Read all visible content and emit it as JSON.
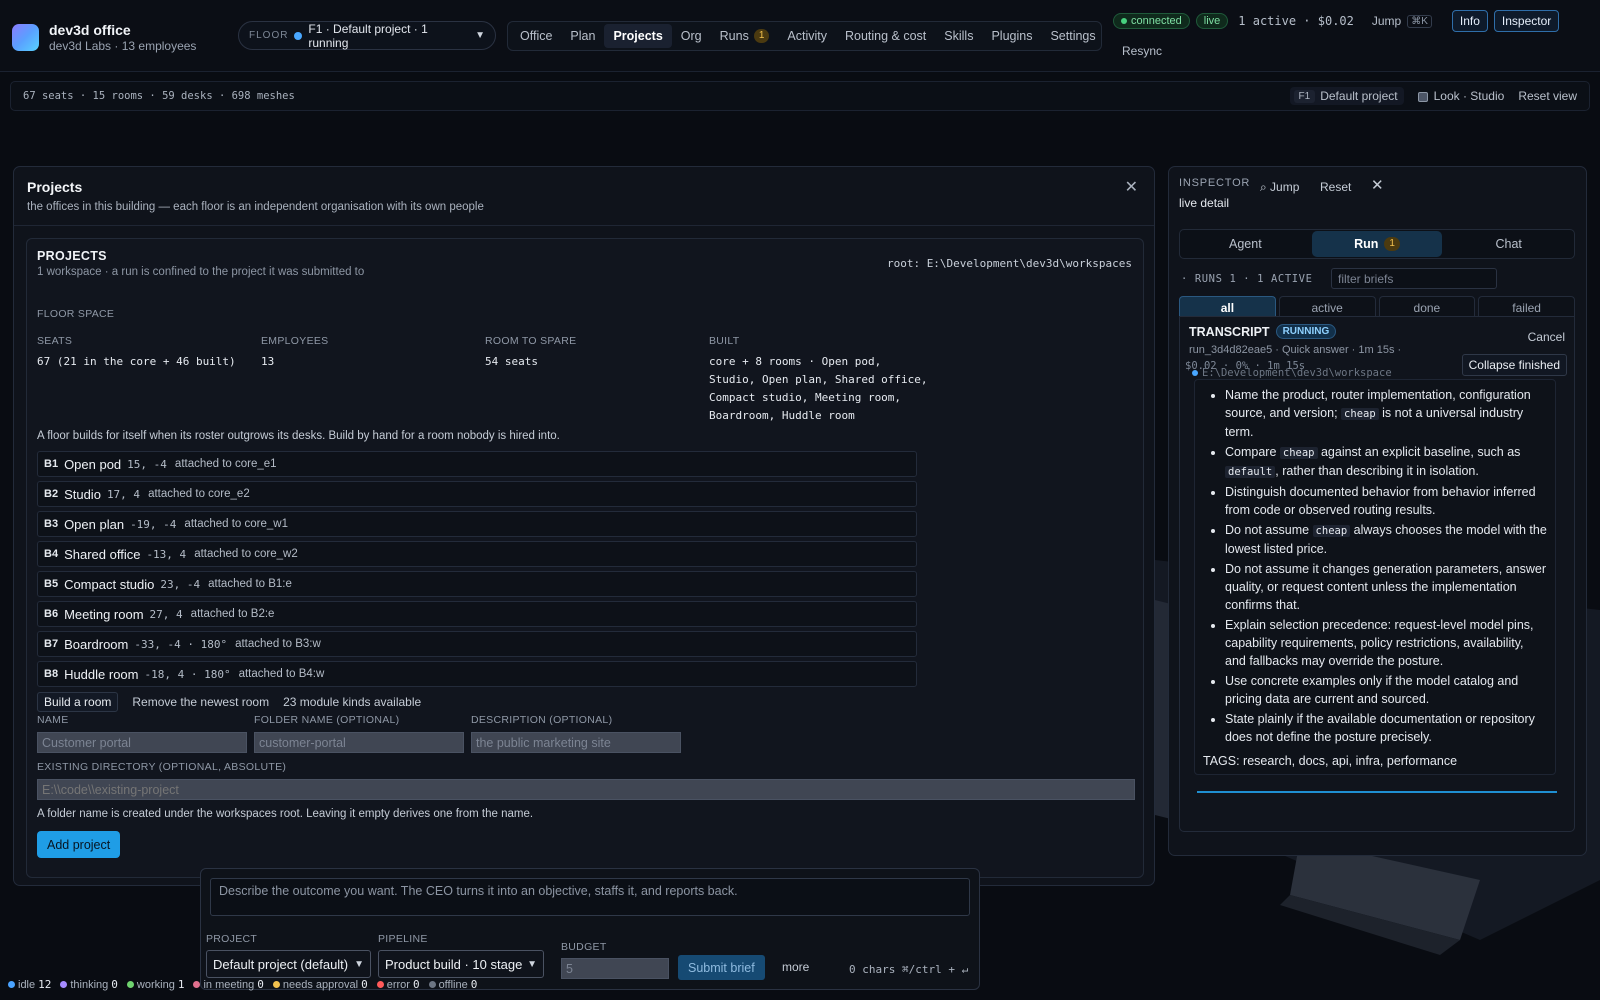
{
  "brand": {
    "name": "dev3d office",
    "subtitle": "dev3d Labs · 13 employees"
  },
  "floor": {
    "label": "FLOOR",
    "value": "F1 · Default project · 1 running"
  },
  "nav": [
    {
      "label": "Office"
    },
    {
      "label": "Plan"
    },
    {
      "label": "Projects",
      "active": true
    },
    {
      "label": "Org"
    },
    {
      "label": "Runs",
      "badge": "1"
    },
    {
      "label": "Activity"
    },
    {
      "label": "Routing & cost"
    },
    {
      "label": "Skills"
    },
    {
      "label": "Plugins"
    },
    {
      "label": "Settings"
    }
  ],
  "status": {
    "connected": "connected",
    "live": "live",
    "summary": "1 active · $0.02",
    "jump": "Jump",
    "jump_kbd": "⌘K",
    "info": "Info",
    "inspector": "Inspector",
    "resync": "Resync"
  },
  "subbar": {
    "stats": "67 seats · 15 rooms · 59 desks · 698 meshes",
    "floor_tag": "F1",
    "project": "Default project",
    "look": "Look · Studio",
    "reset": "Reset view"
  },
  "projects": {
    "title": "Projects",
    "subtitle": "the offices in this building — each floor is an independent organisation with its own people",
    "card_title": "PROJECTS",
    "card_sub": "1 workspace · a run is confined to the project it was submitted to",
    "root": "root: E:\\Development\\dev3d\\workspaces",
    "floor_space": "FLOOR SPACE",
    "stats": {
      "seats_label": "SEATS",
      "seats": "67 (21 in the core + 46 built)",
      "employees_label": "EMPLOYEES",
      "employees": "13",
      "spare_label": "ROOM TO SPARE",
      "spare": "54 seats",
      "built_label": "BUILT",
      "built": "core + 8 rooms · Open pod, Studio, Open plan, Shared office, Compact studio, Meeting room, Boardroom, Huddle room"
    },
    "build_note": "A floor builds for itself when its roster outgrows its desks. Build by hand for a room nobody is hired into.",
    "rooms": [
      {
        "id": "B1",
        "name": "Open pod",
        "coord": "15, -4",
        "attached": "attached to core_e1"
      },
      {
        "id": "B2",
        "name": "Studio",
        "coord": "17, 4",
        "attached": "attached to core_e2"
      },
      {
        "id": "B3",
        "name": "Open plan",
        "coord": "-19, -4",
        "attached": "attached to core_w1"
      },
      {
        "id": "B4",
        "name": "Shared office",
        "coord": "-13, 4",
        "attached": "attached to core_w2"
      },
      {
        "id": "B5",
        "name": "Compact studio",
        "coord": "23, -4",
        "attached": "attached to B1:e"
      },
      {
        "id": "B6",
        "name": "Meeting room",
        "coord": "27, 4",
        "attached": "attached to B2:e"
      },
      {
        "id": "B7",
        "name": "Boardroom",
        "coord": "-33, -4 · 180°",
        "attached": "attached to B3:w"
      },
      {
        "id": "B8",
        "name": "Huddle room",
        "coord": "-18, 4 · 180°",
        "attached": "attached to B4:w"
      }
    ],
    "build_button": "Build a room",
    "remove_link": "Remove the newest room",
    "module_kinds": "23 module kinds available",
    "form": {
      "name_label": "NAME",
      "name_placeholder": "Customer portal",
      "folder_label": "FOLDER NAME (OPTIONAL)",
      "folder_placeholder": "customer-portal",
      "desc_label": "DESCRIPTION (OPTIONAL)",
      "desc_placeholder": "the public marketing site",
      "dir_label": "EXISTING DIRECTORY (OPTIONAL, ABSOLUTE)",
      "dir_placeholder": "E:\\\\code\\\\existing-project",
      "note": "A folder name is created under the workspaces root. Leaving it empty derives one from the name.",
      "add_button": "Add project"
    }
  },
  "inspector": {
    "title": "INSPECTOR",
    "subtitle": "live detail",
    "jump": "⌕ Jump",
    "reset": "Reset",
    "tabs": [
      {
        "label": "Agent"
      },
      {
        "label": "Run",
        "badge": "1",
        "active": true
      },
      {
        "label": "Chat"
      }
    ],
    "runs_line": "· RUNS 1 · 1 ACTIVE",
    "filter_placeholder": "filter briefs",
    "filters": [
      {
        "label": "all",
        "active": true
      },
      {
        "label": "active"
      },
      {
        "label": "done"
      },
      {
        "label": "failed"
      }
    ],
    "transcript": {
      "title": "TRANSCRIPT",
      "status": "RUNNING",
      "cancel": "Cancel",
      "meta": "run_3d4d82eae5 · Quick answer · 1m 15s ·",
      "meta2": "$0.02 · 0% · 1m 15s",
      "collapse": "Collapse finished",
      "path": "E:\\Development\\dev3d\\workspace",
      "items": [
        [
          "Name the product, router implementation, configuration source, and version; ",
          "cheap",
          " is not a universal industry term."
        ],
        [
          "Compare ",
          "cheap",
          " against an explicit baseline, such as ",
          "default",
          ", rather than describing it in isolation."
        ],
        [
          "Distinguish documented behavior from behavior inferred from code or observed routing results."
        ],
        [
          "Do not assume ",
          "cheap",
          " always chooses the model with the lowest listed price."
        ],
        [
          "Do not assume it changes generation parameters, answer quality, or request content unless the implementation confirms that."
        ],
        [
          "Explain selection precedence: request-level model pins, capability requirements, policy restrictions, availability, and fallbacks may override the posture."
        ],
        [
          "Use concrete examples only if the model catalog and pricing data are current and sourced."
        ],
        [
          "State plainly if the available documentation or repository does not define the posture precisely."
        ]
      ],
      "tags": "TAGS: research, docs, api, infra, performance"
    }
  },
  "composer": {
    "placeholder": "Describe the outcome you want. The CEO turns it into an objective, staffs it, and reports back.",
    "project_label": "PROJECT",
    "project_value": "Default project (default)",
    "pipeline_label": "PIPELINE",
    "pipeline_value": "Product build · 10 stage",
    "budget_label": "BUDGET",
    "budget_placeholder": "5",
    "submit": "Submit brief",
    "more": "more",
    "chars": "0 chars ⌘/ctrl + ↵"
  },
  "legend": [
    {
      "label": "idle",
      "count": "12",
      "color": "#4aa3ff"
    },
    {
      "label": "thinking",
      "count": "0",
      "color": "#a58bff"
    },
    {
      "label": "working",
      "count": "1",
      "color": "#6fd36f"
    },
    {
      "label": "in meeting",
      "count": "0",
      "color": "#e0708e"
    },
    {
      "label": "needs approval",
      "count": "0",
      "color": "#f2c14e"
    },
    {
      "label": "error",
      "count": "0",
      "color": "#ff5a5a"
    },
    {
      "label": "offline",
      "count": "0",
      "color": "#6d7684"
    }
  ]
}
